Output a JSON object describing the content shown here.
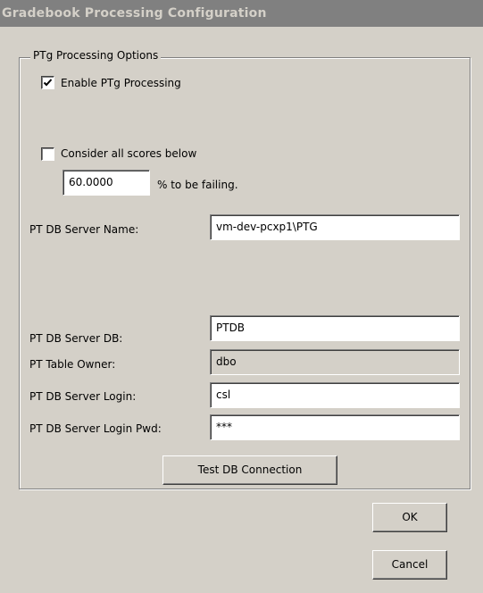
{
  "window": {
    "title": "Gradebook Processing Configuration"
  },
  "group": {
    "legend": "PTg Processing Options"
  },
  "enable_ptg": {
    "label": "Enable PTg Processing",
    "checked": true
  },
  "failing": {
    "label": "Consider all scores below",
    "checked": false,
    "threshold": "60.0000",
    "suffix": "% to be failing."
  },
  "fields": {
    "server_name": {
      "label": "PT DB Server Name:",
      "value": "vm-dev-pcxp1\\PTG"
    },
    "server_db": {
      "label": "PT DB Server DB:",
      "value": "PTDB"
    },
    "table_owner": {
      "label": "PT Table Owner:",
      "value": "dbo"
    },
    "server_login": {
      "label": "PT DB Server Login:",
      "value": "csl"
    },
    "login_pwd": {
      "label": "PT DB Server Login Pwd:",
      "value": "***"
    }
  },
  "buttons": {
    "test_connection": "Test DB Connection",
    "ok": "OK",
    "cancel": "Cancel"
  },
  "colors": {
    "titlebar": "#808080",
    "dialog": "#d4d0c8"
  }
}
